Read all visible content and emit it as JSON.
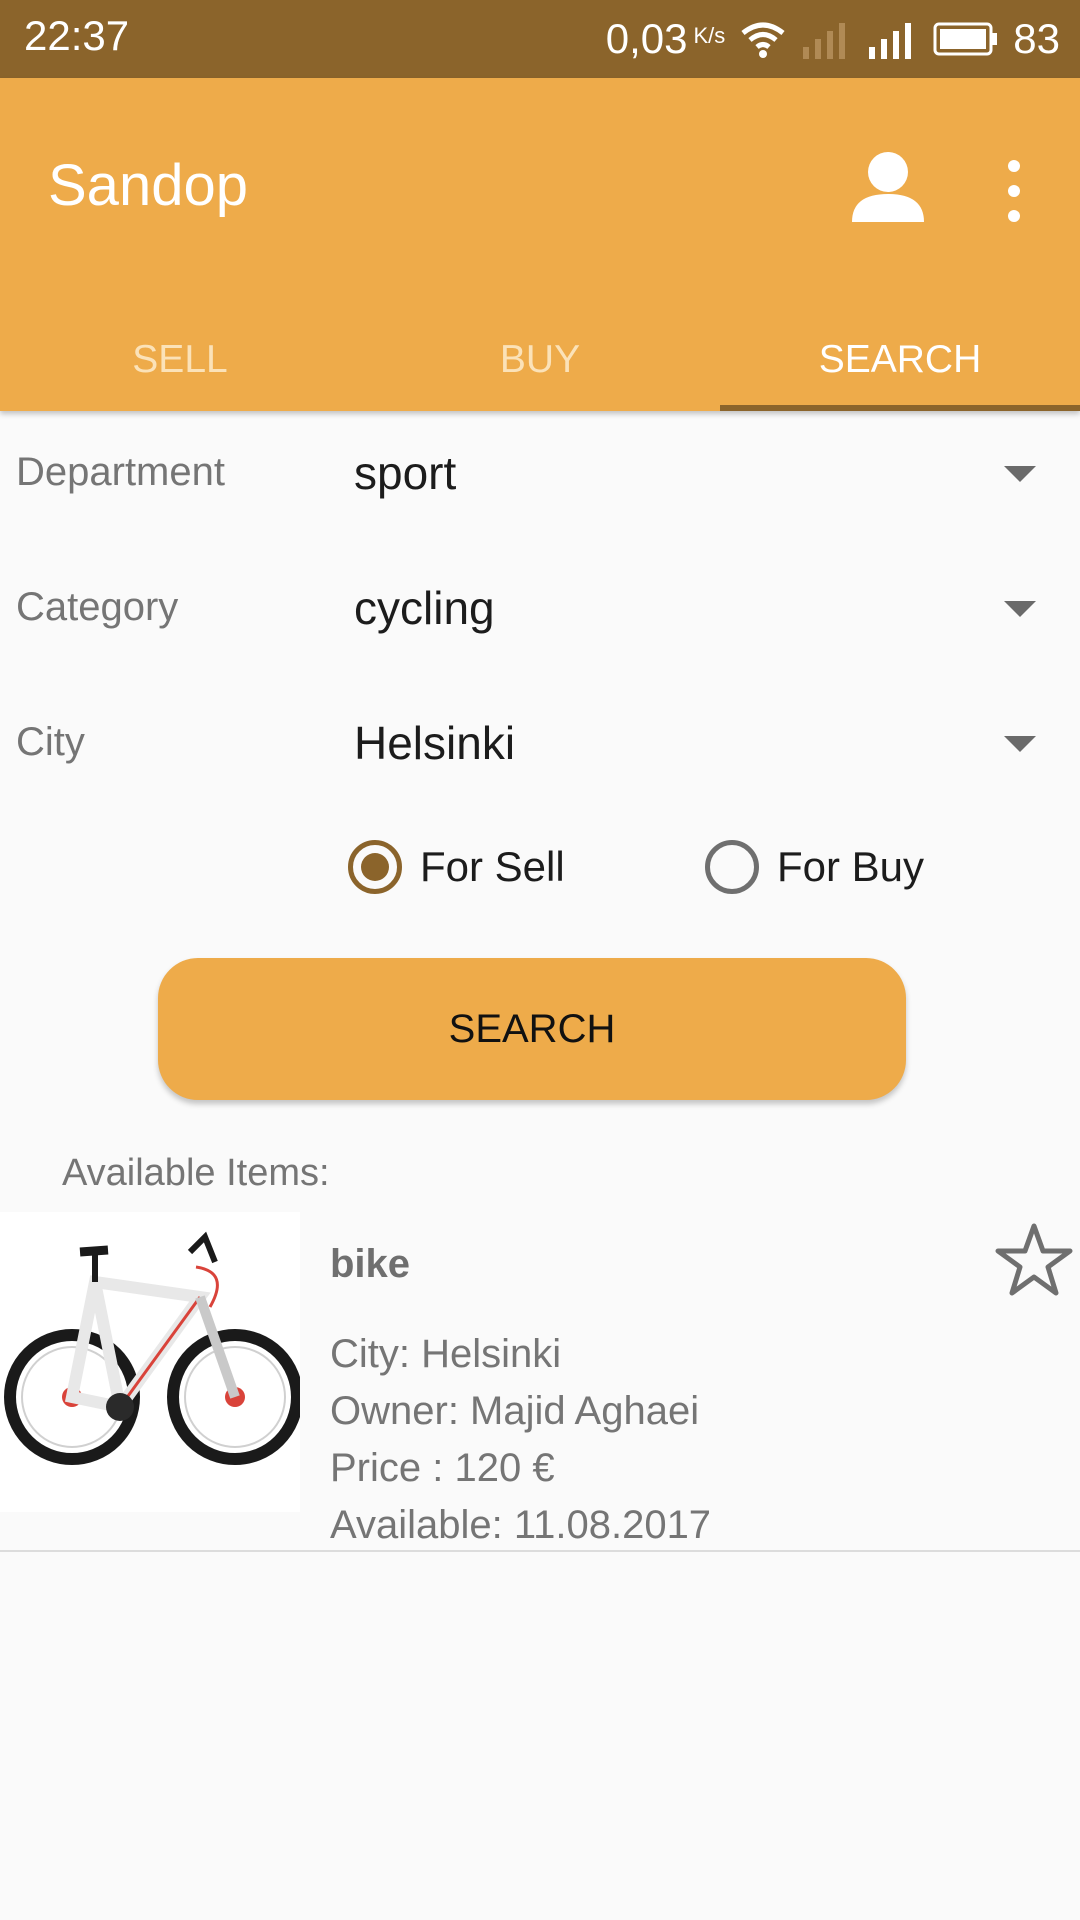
{
  "status_bar": {
    "time": "22:37",
    "speed": "0,03",
    "speed_unit": "K/s",
    "battery": "83",
    "icons": [
      "wifi-icon",
      "signal-empty-icon",
      "signal-icon",
      "battery-icon"
    ]
  },
  "app": {
    "title": "Sandop",
    "actions": [
      "profile-icon",
      "more-vert-icon"
    ]
  },
  "tabs": [
    {
      "label": "SELL",
      "active": false
    },
    {
      "label": "BUY",
      "active": false
    },
    {
      "label": "SEARCH",
      "active": true
    }
  ],
  "form": {
    "department": {
      "label": "Department",
      "value": "sport"
    },
    "category": {
      "label": "Category",
      "value": "cycling"
    },
    "city": {
      "label": "City",
      "value": "Helsinki"
    },
    "radio": [
      {
        "label": "For Sell",
        "checked": true
      },
      {
        "label": "For Buy",
        "checked": false
      }
    ],
    "search_label": "SEARCH"
  },
  "results": {
    "label": "Available Items:",
    "items": [
      {
        "name": "bike",
        "city": "City: Helsinki",
        "owner": "Owner: Majid Aghaei",
        "price": "Price : 120 €",
        "available": "Available: 11.08.2017",
        "favorite": false
      }
    ]
  },
  "colors": {
    "primary": "#eeab4a",
    "primary_dark": "#8b642b",
    "background": "#fafafa"
  }
}
